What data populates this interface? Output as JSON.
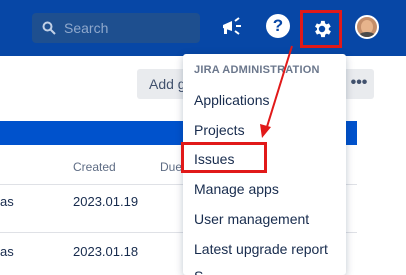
{
  "header": {
    "search_placeholder": "Search",
    "help_symbol": "?",
    "icons": [
      "search-icon",
      "announcement-icon",
      "help-icon",
      "gear-icon",
      "avatar"
    ],
    "brand_color": "#0747a6"
  },
  "toolbar": {
    "add_label": "Add g",
    "more_label": "•••"
  },
  "table": {
    "columns": [
      "Created",
      "Due"
    ],
    "rows": [
      {
        "prefix": "as",
        "created": "2023.01.19"
      },
      {
        "prefix": "as",
        "created": "2023.01.18"
      }
    ]
  },
  "dropdown": {
    "heading": "JIRA ADMINISTRATION",
    "items": [
      {
        "label": "Applications"
      },
      {
        "label": "Projects"
      },
      {
        "label": "Issues"
      },
      {
        "label": "Manage apps"
      },
      {
        "label": "User management"
      },
      {
        "label": "Latest upgrade report"
      },
      {
        "label": "S"
      }
    ]
  },
  "annotation": {
    "highlight_color": "#e11919"
  }
}
